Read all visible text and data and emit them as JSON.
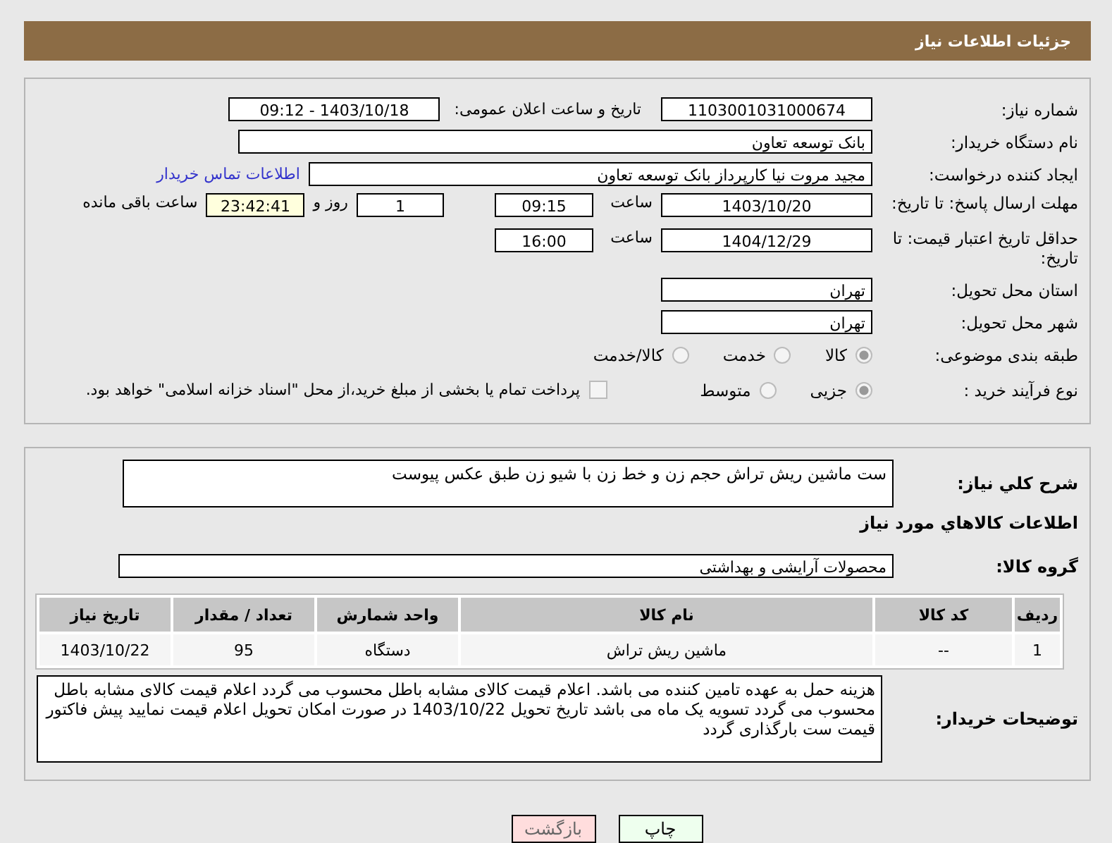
{
  "header": {
    "title": "جزئیات اطلاعات نیاز"
  },
  "details": {
    "need_number": {
      "label": "شماره نیاز:",
      "value": "1103001031000674"
    },
    "announce": {
      "label": "تاریخ و ساعت اعلان عمومی:",
      "value": "1403/10/18 - 09:12"
    },
    "buyer": {
      "label": "نام دستگاه خریدار:",
      "value": "بانک توسعه تعاون"
    },
    "creator": {
      "label": "ایجاد کننده درخواست:",
      "value": "مجید مروت نیا کارپرداز بانک توسعه تعاون",
      "link": "اطلاعات تماس خریدار"
    },
    "deadline": {
      "label": "مهلت ارسال پاسخ: تا تاریخ:",
      "date": "1403/10/20",
      "time_label": "ساعت",
      "time": "09:15",
      "days": "1",
      "days_label": "روز و",
      "remaining": "23:42:41",
      "remaining_label": "ساعت باقی مانده"
    },
    "validity": {
      "label": "حداقل تاریخ اعتبار قیمت: تا تاریخ:",
      "date": "1404/12/29",
      "time_label": "ساعت",
      "time": "16:00"
    },
    "province": {
      "label": "استان محل تحویل:",
      "value": "تهران"
    },
    "city": {
      "label": "شهر محل تحویل:",
      "value": "تهران"
    },
    "category": {
      "label": "طبقه بندی موضوعی:",
      "options": [
        {
          "label": "کالا",
          "selected": true
        },
        {
          "label": "خدمت",
          "selected": false
        },
        {
          "label": "کالا/خدمت",
          "selected": false
        }
      ]
    },
    "process": {
      "label": "نوع فرآیند خرید :",
      "options": [
        {
          "label": "جزیی",
          "selected": true
        },
        {
          "label": "متوسط",
          "selected": false
        }
      ],
      "treasury": {
        "label": "پرداخت تمام یا بخشی از مبلغ خرید،از محل \"اسناد خزانه اسلامی\" خواهد بود.",
        "checked": false
      }
    }
  },
  "summary": {
    "label": "شرح کلي نياز:",
    "value": "ست ماشین ریش تراش حجم زن و خط زن با شیو زن طبق عکس پیوست"
  },
  "goods_heading": "اطلاعات کالاهاي مورد نياز",
  "goods_group": {
    "label": "گروه کالا:",
    "value": "محصولات آرایشی و بهداشتی"
  },
  "table": {
    "columns": [
      "ردیف",
      "کد کالا",
      "نام کالا",
      "واحد شمارش",
      "تعداد / مقدار",
      "تاریخ نیاز"
    ],
    "rows": [
      [
        "1",
        "--",
        "ماشین ریش تراش",
        "دستگاه",
        "95",
        "1403/10/22"
      ]
    ]
  },
  "notes": {
    "label": "توضیحات خریدار:",
    "value": "هزینه حمل به عهده تامین کننده می باشد. اعلام قیمت کالای مشابه باطل محسوب می گردد اعلام قیمت کالای مشابه باطل محسوب می گردد تسویه یک ماه می باشد تاریخ تحویل 1403/10/22 در صورت امکان تحویل اعلام قیمت نمایید پیش فاکتور قیمت ست بارگذاری گردد"
  },
  "buttons": [
    {
      "label": "چاپ",
      "kind": "print"
    },
    {
      "label": "بازگشت",
      "kind": "back"
    }
  ]
}
